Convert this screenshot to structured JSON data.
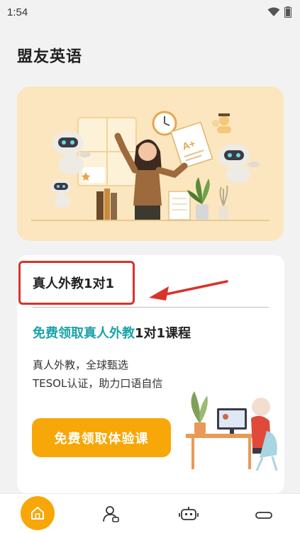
{
  "status_bar": {
    "time": "1:54"
  },
  "header": {
    "app_title": "盟友英语"
  },
  "card": {
    "heading": "真人外教1对1",
    "promo_highlight": "免费领取真人外教",
    "promo_rest": "1对1课程",
    "desc_line1": "真人外教，全球甄选",
    "desc_line2": "TESOL认证，助力口语自信",
    "cta_label": "免费领取体验课"
  },
  "colors": {
    "accent_orange": "#f7a707",
    "teal": "#1aa3a8",
    "annotation_red": "#d9332a",
    "hero_bg": "#fbe6bf"
  },
  "icons": {
    "wifi": "wifi-icon",
    "battery": "battery-icon",
    "home": "home-icon",
    "profile": "profile-icon",
    "robot": "robot-icon",
    "nav_handle": "nav-handle-icon"
  }
}
